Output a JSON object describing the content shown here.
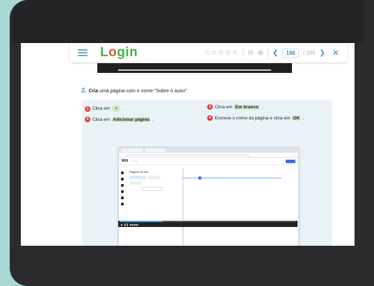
{
  "app": {
    "logo_text": "Login",
    "logo_o": "o",
    "logo_before": "L",
    "logo_after": "gin",
    "brand_colors": {
      "green": "#46b34a",
      "orange": "#e8542f",
      "accent": "#3d8fb8"
    }
  },
  "toolbar": {
    "stars": "☆☆☆☆☆",
    "zoom_out_icon": "zoom-out-icon",
    "zoom_in_icon": "zoom-in-icon",
    "page_current": "106",
    "page_total": "/ 395",
    "prev_icon": "chevron-left-icon",
    "next_icon": "chevron-right-icon",
    "close_icon": "close-icon"
  },
  "content": {
    "step_number": "2.",
    "step_text_bold": "Cria",
    "step_text_rest": " uma página com o nome “Sobre o autor”.",
    "instructions": [
      {
        "num": "1",
        "before": "Clica em ",
        "chip": "+",
        "after": "."
      },
      {
        "num": "2",
        "before": "Clica em ",
        "highlight": "Adicionar página",
        "after": "."
      },
      {
        "num": "3",
        "before": "Clica em ",
        "highlight": "Em branco",
        "after": "."
      },
      {
        "num": "4",
        "before": "Escreve o nome da página e clica em ",
        "highlight": "OK",
        "after": "."
      }
    ],
    "screenshot": {
      "brand": "WiX",
      "panel_title": "Páginas do site"
    }
  }
}
